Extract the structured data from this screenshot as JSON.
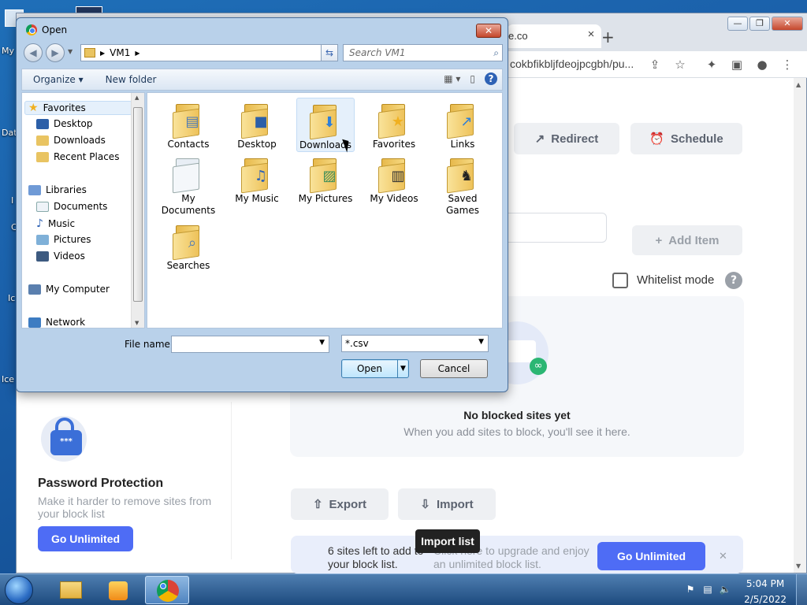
{
  "desktop": {
    "icon_labels": [
      "My",
      "Dat",
      "I",
      "C",
      "Ic",
      "Ice"
    ]
  },
  "chrome": {
    "tab_fragment": "e.co",
    "tab_close": "×",
    "new_tab": "+",
    "url_fragment": "cokbfikbljfdeojpcgbh/pu...",
    "win_minimize": "—",
    "win_maximize": "❐",
    "win_close": "✕"
  },
  "page": {
    "redirect_label": "Redirect",
    "schedule_label": "Schedule",
    "add_item_label": "Add Item",
    "whitelist_label": "Whitelist mode",
    "help_symbol": "?",
    "empty_title": "No blocked sites yet",
    "empty_subtitle": "When you add sites to block, you'll see it here.",
    "password_title": "Password Protection",
    "password_desc": "Make it harder to remove sites from your block list",
    "lock_text": "***",
    "go_unlimited_small": "Go Unlimited",
    "export_label": "Export",
    "import_label": "Import",
    "tooltip": "Import list",
    "sites_left": "6 sites left to add to your block list.",
    "upgrade_text": "Click here to upgrade and enjoy an unlimited block list.",
    "go_unlimited_banner": "Go Unlimited",
    "banner_close": "✕"
  },
  "dialog": {
    "title": "Open",
    "close": "✕",
    "path": [
      "VM1"
    ],
    "search_placeholder": "Search VM1",
    "organize": "Organize ▾",
    "new_folder": "New folder",
    "help": "?",
    "nav": [
      {
        "label": "Favorites",
        "group": true
      },
      {
        "label": "Desktop"
      },
      {
        "label": "Downloads"
      },
      {
        "label": "Recent Places"
      },
      {
        "label": "Libraries",
        "group": true
      },
      {
        "label": "Documents"
      },
      {
        "label": "Music"
      },
      {
        "label": "Pictures"
      },
      {
        "label": "Videos"
      },
      {
        "label": "My Computer",
        "group": true
      },
      {
        "label": "Network",
        "group": true
      }
    ],
    "folders": [
      {
        "name": "Contacts",
        "icon": "contacts-icon"
      },
      {
        "name": "Desktop",
        "icon": "desktop-icon"
      },
      {
        "name": "Downloads",
        "icon": "download-arrow-icon"
      },
      {
        "name": "Favorites",
        "icon": "star-icon"
      },
      {
        "name": "Links",
        "icon": "link-arrow-icon"
      },
      {
        "name": "My Documents",
        "icon": "document-icon"
      },
      {
        "name": "My Music",
        "icon": "music-note-icon"
      },
      {
        "name": "My Pictures",
        "icon": "picture-icon"
      },
      {
        "name": "My Videos",
        "icon": "film-icon"
      },
      {
        "name": "Saved Games",
        "icon": "chess-piece-icon"
      },
      {
        "name": "Searches",
        "icon": "magnifier-icon"
      }
    ],
    "file_name_label": "File name:",
    "file_name_value": "",
    "file_type": "*.csv",
    "open_button": "Open",
    "cancel_button": "Cancel"
  },
  "taskbar": {
    "time": "5:04 PM",
    "date": "2/5/2022"
  }
}
